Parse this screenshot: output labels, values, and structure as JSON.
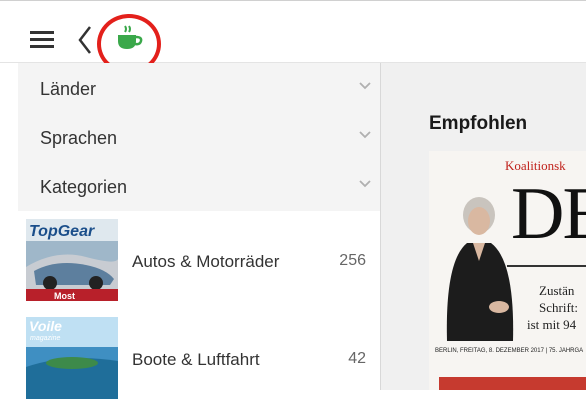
{
  "sidebar": {
    "filters": [
      {
        "label": "Länder"
      },
      {
        "label": "Sprachen"
      },
      {
        "label": "Kategorien"
      }
    ],
    "categories": [
      {
        "name": "Autos & Motorräder",
        "count": "256",
        "thumb_title": "TopGear",
        "thumb_caption": "Most"
      },
      {
        "name": "Boote & Luftfahrt",
        "count": "42",
        "thumb_title": "Voile",
        "thumb_subtitle": "magazine"
      }
    ]
  },
  "main": {
    "section_title": "Empfohlen",
    "featured": {
      "kicker": "Koalitionsk",
      "masthead": "DE",
      "sub_lines": [
        "Zustän",
        "Schrift:",
        "ist mit 94"
      ],
      "dateline": "BERLIN, FREITAG, 8. DEZEMBER 2017 | 75. JAHRGA"
    }
  },
  "colors": {
    "accent_green": "#3aa84a",
    "highlight_red": "#e3201b"
  },
  "icons": {
    "menu": "hamburger-icon",
    "back": "chevron-left-icon",
    "app": "coffee-cup-icon",
    "expand": "chevron-down-icon"
  }
}
